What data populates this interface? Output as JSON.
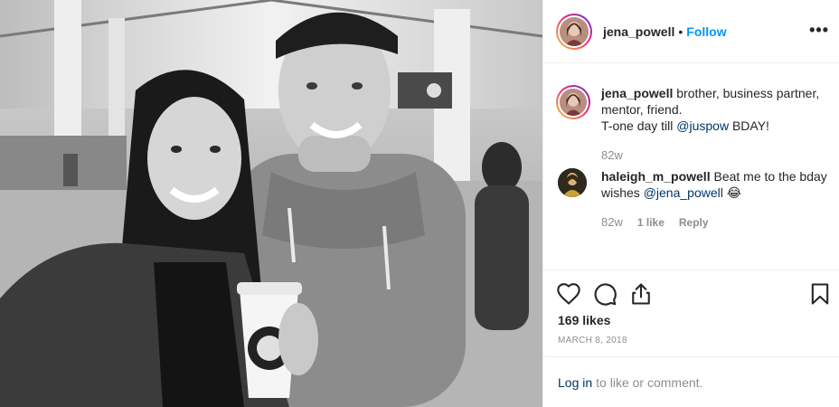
{
  "post": {
    "username": "jena_powell",
    "follow_label": "Follow",
    "more_label": "•••",
    "likes": "169 likes",
    "date": "MARCH 8, 2018",
    "photo_alt": "photo"
  },
  "caption": {
    "username": "jena_powell",
    "text_part1": "brother, business partner, mentor, friend.",
    "text_part2": "T-one day till",
    "mention": "@juspow",
    "text_part3": "BDAY!",
    "time": "82w"
  },
  "comment": {
    "username": "haleigh_m_powell",
    "text": "Beat me to the bday wishes",
    "mention": "@jena_powell",
    "emoji": "😂",
    "time": "82w",
    "likes": "1 like",
    "reply_label": "Reply"
  },
  "login": {
    "link_label": "Log in",
    "rest": "to like or comment."
  },
  "icons": [
    "heart-icon",
    "comment-icon",
    "share-icon",
    "bookmark-icon"
  ],
  "colors": {
    "accent": "#0095f6",
    "link": "#003569",
    "muted": "#8e8e8e",
    "text": "#262626"
  }
}
